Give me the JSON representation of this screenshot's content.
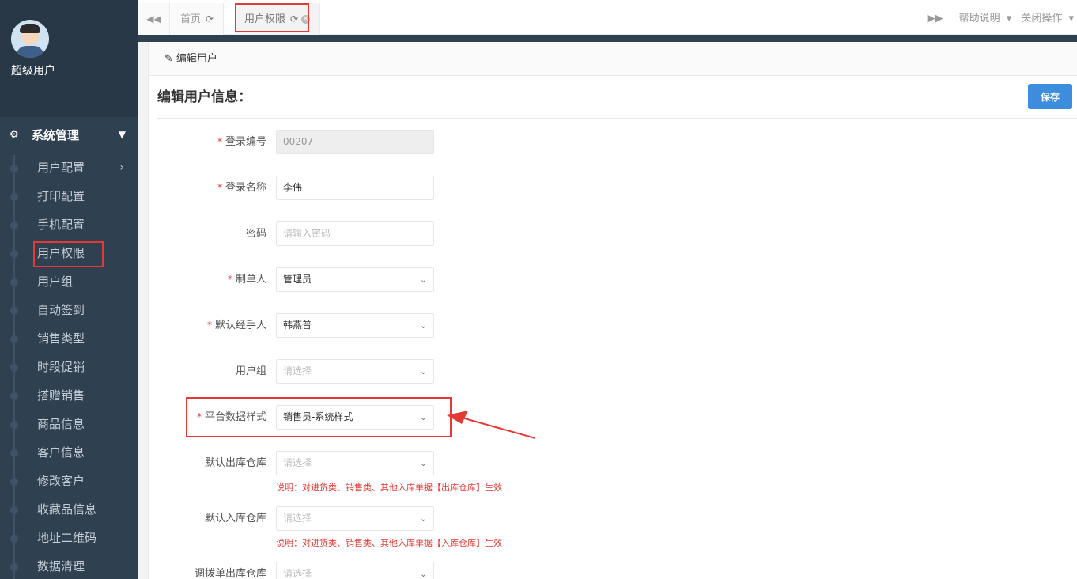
{
  "sidebar": {
    "user_name": "超级用户",
    "section_title": "系统管理",
    "items": [
      {
        "label": "用户配置",
        "has_arrow": true
      },
      {
        "label": "打印配置"
      },
      {
        "label": "手机配置"
      },
      {
        "label": "用户权限"
      },
      {
        "label": "用户组"
      },
      {
        "label": "自动签到"
      },
      {
        "label": "销售类型"
      },
      {
        "label": "时段促销"
      },
      {
        "label": "搭赠销售"
      },
      {
        "label": "商品信息"
      },
      {
        "label": "客户信息"
      },
      {
        "label": "修改客户"
      },
      {
        "label": "收藏品信息"
      },
      {
        "label": "地址二维码"
      },
      {
        "label": "数据清理"
      }
    ]
  },
  "tabs": {
    "home": "首页",
    "active": "用户权限",
    "help": "帮助说明",
    "close_ops": "关闭操作"
  },
  "breadcrumb": "编辑用户",
  "page": {
    "title": "编辑用户信息：",
    "save_label": "保存"
  },
  "form": {
    "login_no_label": "登录编号",
    "login_no_value": "00207",
    "login_name_label": "登录名称",
    "login_name_value": "李伟",
    "password_label": "密码",
    "password_placeholder": "请输入密码",
    "maker_label": "制单人",
    "maker_value": "管理员",
    "handler_label": "默认经手人",
    "handler_value": "韩燕普",
    "group_label": "用户组",
    "group_placeholder": "请选择",
    "platform_style_label": "平台数据样式",
    "platform_style_value": "销售员-系统样式",
    "out_wh_label": "默认出库仓库",
    "out_wh_placeholder": "请选择",
    "out_wh_note": "说明：对进货类、销售类、其他入库单据【出库仓库】生效",
    "in_wh_label": "默认入库仓库",
    "in_wh_placeholder": "请选择",
    "in_wh_note": "说明：对进货类、销售类、其他入库单据【入库仓库】生效",
    "transfer_out_label": "调拨单出库仓库",
    "transfer_out_placeholder": "请选择"
  },
  "colors": {
    "sidebar_bg": "#2f4050",
    "primary_button": "#3c8dde",
    "required_red": "#e53935"
  }
}
